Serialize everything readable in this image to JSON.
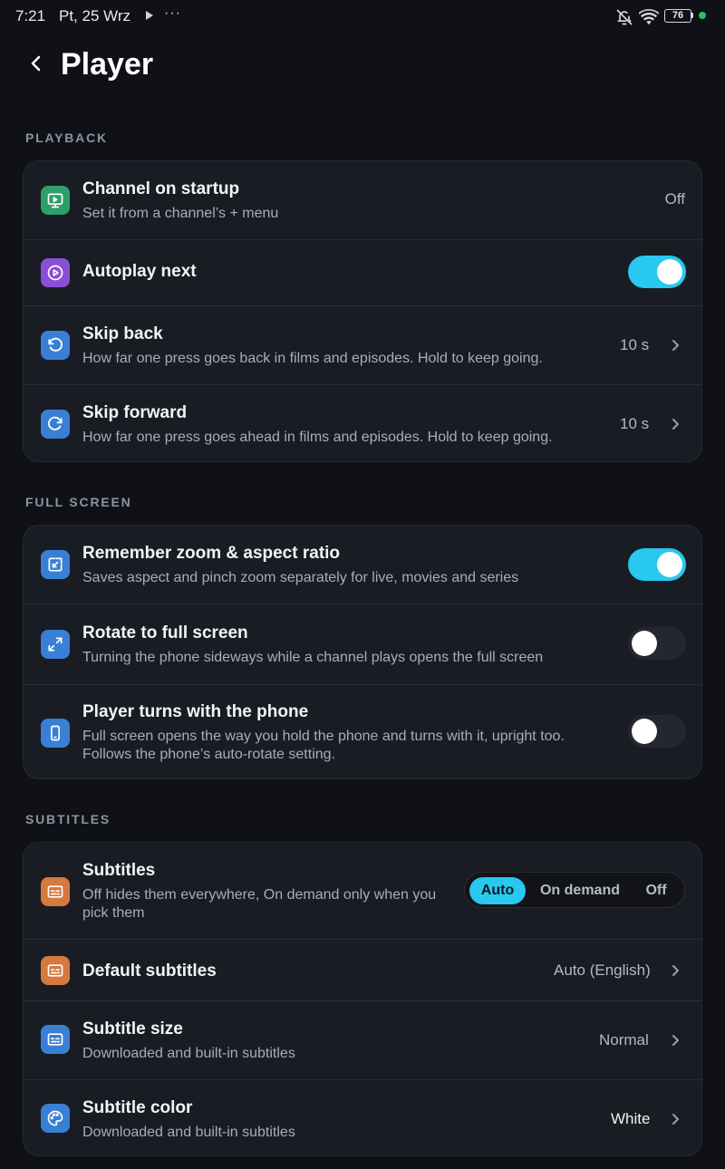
{
  "status_bar": {
    "time": "7:21",
    "date": "Pt, 25 Wrz",
    "more": "···",
    "battery": "76"
  },
  "header": {
    "title": "Player"
  },
  "colors": {
    "accent": "#28c8f0",
    "green": "#2e9e6a",
    "purple": "#8a4fd6",
    "blue": "#3a7fd6",
    "orange": "#d5793f"
  },
  "playback": {
    "heading": "PLAYBACK",
    "channel_on_startup": {
      "title": "Channel on startup",
      "subtitle": "Set it from a channel’s + menu",
      "value": "Off",
      "icon": "tv-play-icon"
    },
    "autoplay_next": {
      "title": "Autoplay next",
      "enabled": true,
      "icon": "play-circle-icon"
    },
    "skip_back": {
      "title": "Skip back",
      "subtitle": "How far one press goes back in films and episodes. Hold to keep going.",
      "value": "10 s",
      "icon": "rotate-ccw-icon"
    },
    "skip_forward": {
      "title": "Skip forward",
      "subtitle": "How far one press goes ahead in films and episodes. Hold to keep going.",
      "value": "10 s",
      "icon": "rotate-cw-icon"
    }
  },
  "full_screen": {
    "heading": "FULL SCREEN",
    "remember_zoom": {
      "title": "Remember zoom & aspect ratio",
      "subtitle": "Saves aspect and pinch zoom separately for live, movies and series",
      "enabled": true,
      "icon": "resize-icon"
    },
    "rotate_full_screen": {
      "title": "Rotate to full screen",
      "subtitle": "Turning the phone sideways while a channel plays opens the full screen",
      "enabled": false,
      "icon": "expand-icon"
    },
    "player_turns": {
      "title": "Player turns with the phone",
      "subtitle_line1": "Full screen opens the way you hold the phone and turns with it, upright too.",
      "subtitle_line2": "Follows the phone’s auto-rotate setting.",
      "enabled": false,
      "icon": "phone-icon"
    }
  },
  "subtitles": {
    "heading": "SUBTITLES",
    "mode": {
      "title": "Subtitles",
      "subtitle_line1": "Off hides them everywhere, On demand only when you",
      "subtitle_line2": "pick them",
      "options": [
        "Auto",
        "On demand",
        "Off"
      ],
      "selected": "Auto",
      "icon": "captions-icon"
    },
    "default_subtitles": {
      "title": "Default subtitles",
      "value": "Auto (English)",
      "icon": "captions-icon"
    },
    "subtitle_size": {
      "title": "Subtitle size",
      "subtitle": "Downloaded and built-in subtitles",
      "value": "Normal",
      "icon": "captions-icon"
    },
    "subtitle_color": {
      "title": "Subtitle color",
      "subtitle": "Downloaded and built-in subtitles",
      "value": "White",
      "icon": "palette-icon"
    }
  }
}
